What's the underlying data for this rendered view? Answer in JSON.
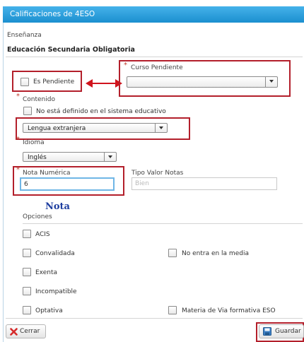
{
  "window": {
    "title": "Calificaciones de 4ESO"
  },
  "form": {
    "ensenanza_label": "Enseñanza",
    "ensenanza_value": "Educación Secundaria Obligatoria",
    "pendiente_label": "Es Pendiente",
    "curso_pendiente_label": "Curso Pendiente",
    "curso_pendiente_value": "",
    "contenido_label": "Contenido",
    "no_definido_label": "No está definido en el sistema educativo",
    "contenido_value": "Lengua extranjera",
    "idioma_label": "Idioma",
    "idioma_value": "Inglés",
    "nota_label": "Nota Numérica",
    "nota_value": "6",
    "tipo_valor_label": "Tipo Valor Notas",
    "tipo_valor_placeholder": "Bien",
    "annotation": "Nota",
    "opciones_label": "Opciones",
    "options": {
      "acis": "ACIS",
      "convalidada": "Convalidada",
      "no_media": "No entra en la media",
      "exenta": "Exenta",
      "incompatible": "Incompatible",
      "optativa": "Optativa",
      "materia_via": "Materia de Via formativa ESO"
    }
  },
  "buttons": {
    "cerrar": "Cerrar",
    "guardar": "Guardar"
  },
  "colors": {
    "title_bar": "#2f9fd9",
    "highlight": "#b31f2b",
    "required": "#c0392b",
    "annotation": "#1f3fa0"
  }
}
